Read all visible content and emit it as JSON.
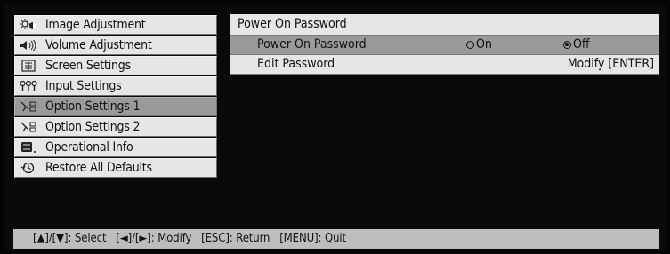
{
  "menu": {
    "items": [
      {
        "label": "Image Adjustment",
        "icon": "image-adjustment-icon"
      },
      {
        "label": "Volume Adjustment",
        "icon": "volume-icon"
      },
      {
        "label": "Screen Settings",
        "icon": "screen-icon"
      },
      {
        "label": "Input Settings",
        "icon": "input-icon"
      },
      {
        "label": "Option Settings 1",
        "icon": "option-settings-icon",
        "selected": true
      },
      {
        "label": "Option Settings 2",
        "icon": "option-settings-icon"
      },
      {
        "label": "Operational Info",
        "icon": "info-icon"
      },
      {
        "label": "Restore All Defaults",
        "icon": "restore-icon"
      }
    ]
  },
  "panel": {
    "title": "Power On Password",
    "rows": [
      {
        "name": "Power On Password",
        "option_on": "On",
        "option_off": "Off",
        "selected_option": "Off"
      },
      {
        "name": "Edit Password",
        "action": "Modify [ENTER]"
      }
    ]
  },
  "footer": {
    "hint": "[▲]/[▼]: Select   [◄]/[►]: Modify   [ESC]: Return   [MENU]: Quit"
  },
  "colors": {
    "background": "#050505",
    "item": "#e6e6e6",
    "selected": "#9a9a9a",
    "footer": "#bdbdbd"
  }
}
